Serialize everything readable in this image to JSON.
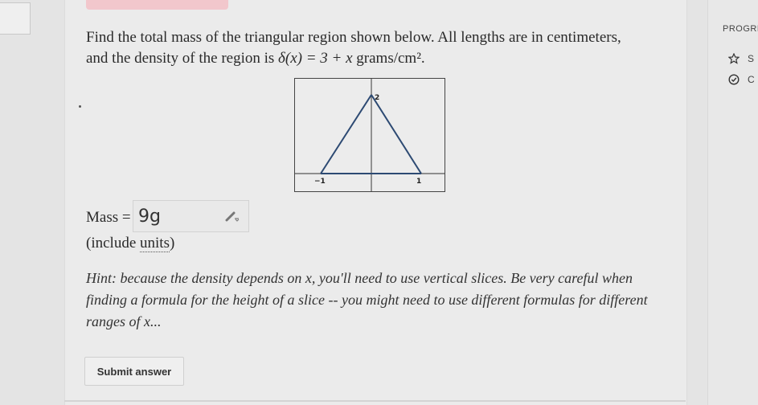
{
  "question": {
    "line1": "Find the total mass of the triangular region shown below. All lengths are in centimeters,",
    "line2_prefix": "and the density of the region is ",
    "density_fn": "δ(x) = 3 + x",
    "line2_suffix": " grams/cm²."
  },
  "graph": {
    "y_label": "2",
    "x_left_label": "−1",
    "x_right_label": "1"
  },
  "answer": {
    "label": "Mass =",
    "value": "9g"
  },
  "include_units": {
    "prefix": "(include ",
    "link": "units",
    "suffix": ")"
  },
  "hint": {
    "text": "Hint: because the density depends on x, you'll need to use vertical slices. Be very careful when finding a formula for the height of a slice -- you might need to use different formulas for different ranges of x..."
  },
  "submit": {
    "label": "Submit answer"
  },
  "sidebar": {
    "progress_label": "PROGRE",
    "items": [
      {
        "icon": "star-icon",
        "label": "S"
      },
      {
        "icon": "check-circle-icon",
        "label": "C"
      }
    ]
  }
}
